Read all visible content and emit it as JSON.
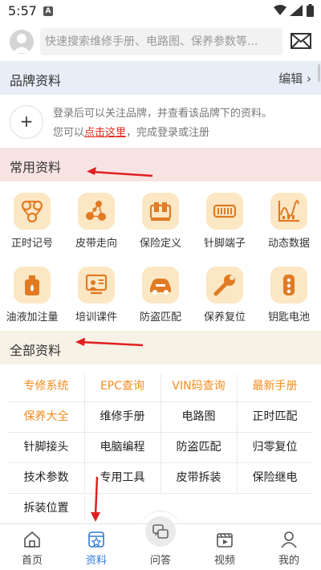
{
  "status_bar": {
    "time": "5:57",
    "badge": "A"
  },
  "search": {
    "placeholder": "快速搜索维修手册、电路图、保养参数等..."
  },
  "brand": {
    "title": "品牌资料",
    "edit": "编辑",
    "add_symbol": "+",
    "line1": "登录后可以关注品牌，并查看该品牌下的资料。",
    "line2_prefix": "您可以",
    "line2_link": "点击这里",
    "line2_suffix": "，完成登录或注册"
  },
  "common": {
    "title": "常用资料",
    "items": [
      {
        "label": "正时记号",
        "icon": "timing-icon"
      },
      {
        "label": "皮带走向",
        "icon": "belt-icon"
      },
      {
        "label": "保险定义",
        "icon": "fuse-icon"
      },
      {
        "label": "针脚端子",
        "icon": "pin-terminal-icon"
      },
      {
        "label": "动态数据",
        "icon": "dynamic-data-icon"
      },
      {
        "label": "油液加注量",
        "icon": "oil-can-icon"
      },
      {
        "label": "培训课件",
        "icon": "training-icon"
      },
      {
        "label": "防盗匹配",
        "icon": "car-key-icon"
      },
      {
        "label": "保养复位",
        "icon": "wrench-icon"
      },
      {
        "label": "钥匙电池",
        "icon": "key-fob-icon"
      }
    ]
  },
  "all": {
    "title": "全部资料",
    "rows": [
      [
        "专修系统",
        "EPC查询",
        "VIN码查询",
        "最新手册"
      ],
      [
        "保养大全",
        "维修手册",
        "电路图",
        "正时匹配"
      ],
      [
        "针脚接头",
        "电脑编程",
        "防盗匹配",
        "归零复位"
      ],
      [
        "技术参数",
        "专用工具",
        "皮带拆装",
        "保险继电"
      ],
      [
        "拆装位置"
      ]
    ]
  },
  "nav": {
    "items": [
      {
        "label": "首页",
        "icon": "home-icon"
      },
      {
        "label": "资料",
        "icon": "docs-icon"
      },
      {
        "label": "问答",
        "icon": "qa-icon"
      },
      {
        "label": "视频",
        "icon": "video-icon"
      },
      {
        "label": "我的",
        "icon": "profile-icon"
      }
    ]
  },
  "colors": {
    "accent_orange": "#f28c1e",
    "link_red": "#e0291a",
    "active_blue": "#2f7ad9",
    "arrow_red": "#e02020"
  }
}
